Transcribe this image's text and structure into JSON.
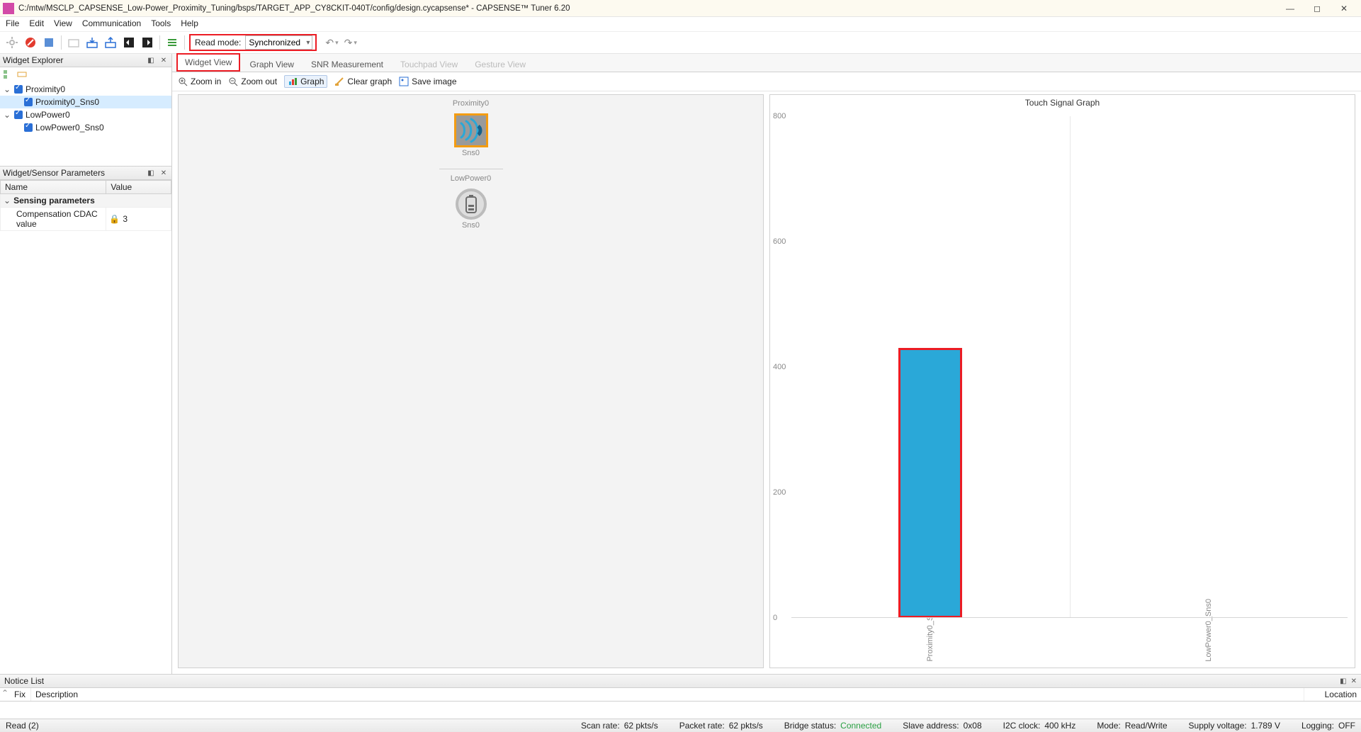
{
  "title": "C:/mtw/MSCLP_CAPSENSE_Low-Power_Proximity_Tuning/bsps/TARGET_APP_CY8CKIT-040T/config/design.cycapsense* - CAPSENSE™ Tuner 6.20",
  "menu": [
    "File",
    "Edit",
    "View",
    "Communication",
    "Tools",
    "Help"
  ],
  "read_mode": {
    "label": "Read mode:",
    "value": "Synchronized"
  },
  "tabs": {
    "widget_view": "Widget View",
    "graph_view": "Graph View",
    "snr": "SNR Measurement",
    "touchpad": "Touchpad View",
    "gesture": "Gesture View"
  },
  "subtoolbar": {
    "zoom_in": "Zoom in",
    "zoom_out": "Zoom out",
    "graph": "Graph",
    "clear_graph": "Clear graph",
    "save_image": "Save image"
  },
  "explorer": {
    "title": "Widget Explorer",
    "items": [
      {
        "name": "Proximity0",
        "children": [
          {
            "name": "Proximity0_Sns0",
            "selected": true
          }
        ]
      },
      {
        "name": "LowPower0",
        "children": [
          {
            "name": "LowPower0_Sns0"
          }
        ]
      }
    ]
  },
  "params": {
    "title": "Widget/Sensor Parameters",
    "cols": {
      "name": "Name",
      "value": "Value"
    },
    "group": "Sensing parameters",
    "rows": [
      {
        "name": "Compensation CDAC value",
        "value": "3"
      }
    ]
  },
  "canvas": {
    "proximity_label": "Proximity0",
    "proximity_sensor": "Sns0",
    "lowpower_label": "LowPower0",
    "lowpower_sensor": "Sns0"
  },
  "chart_data": {
    "type": "bar",
    "title": "Touch Signal Graph",
    "categories": [
      "Proximity0_Sns0",
      "LowPower0_Sns0"
    ],
    "values": [
      430,
      0
    ],
    "ylim": [
      0,
      800
    ],
    "yticks": [
      0,
      200,
      400,
      600,
      800
    ]
  },
  "notice": {
    "title": "Notice List",
    "cols": {
      "fix": "Fix",
      "desc": "Description",
      "loc": "Location"
    }
  },
  "status": {
    "read": "Read (2)",
    "scan_rate_l": "Scan rate:",
    "scan_rate_v": "62 pkts/s",
    "packet_rate_l": "Packet rate:",
    "packet_rate_v": "62 pkts/s",
    "bridge_l": "Bridge status:",
    "bridge_v": "Connected",
    "slave_l": "Slave address:",
    "slave_v": "0x08",
    "i2c_l": "I2C clock:",
    "i2c_v": "400 kHz",
    "mode_l": "Mode:",
    "mode_v": "Read/Write",
    "supply_l": "Supply voltage:",
    "supply_v": "1.789 V",
    "logging_l": "Logging:",
    "logging_v": "OFF"
  }
}
